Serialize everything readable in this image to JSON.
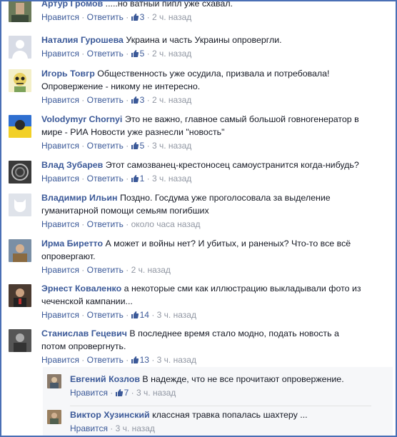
{
  "like_label": "Нравится",
  "reply_label": "Ответить",
  "separator": "·",
  "comments": [
    {
      "author": "Артур Громов",
      "text": ".....но ватный пипл уже схавал.",
      "likes": "3",
      "time": "2 ч. назад"
    },
    {
      "author": "Наталия Гурошева",
      "text": "Украина и часть Украины опровергли.",
      "likes": "5",
      "time": "2 ч. назад"
    },
    {
      "author": "Игорь Товгр",
      "text_line1": "Общественность уже осудила, призвала и потребовала!",
      "text_line2": "Опровержение - никому не интересно.",
      "likes": "3",
      "time": "2 ч. назад"
    },
    {
      "author": "Volodymyr Chornyi",
      "text_line1": "Это не важно, главное самый большой говногенератор в",
      "text_line2": "мире - РИА Новости уже разнесли \"новость\"",
      "likes": "5",
      "time": "3 ч. назад"
    },
    {
      "author": "Влад Зубарев",
      "text": "Этот самозванец-крестоносец самоустранится когда-нибудь?",
      "likes": "1",
      "time": "3 ч. назад"
    },
    {
      "author": "Владимир Ильин",
      "text_line1": "Поздно. Госдума уже проголосовала за выделение",
      "text_line2": "гуманитарной помощи семьям погибших",
      "likes": "",
      "time": "около часа назад"
    },
    {
      "author": "Ирма Биретто",
      "text_line1": "А может и войны нет? И убитых, и раненых? Что-то все всё",
      "text_line2": "опровергают.",
      "likes": "",
      "time": "2 ч. назад"
    },
    {
      "author": "Эрнест Коваленко",
      "text_line1": "а некоторые сми как иллюстрацию выкладывали фото из",
      "text_line2": "чеченской кампании...",
      "likes": "14",
      "time": "3 ч. назад"
    },
    {
      "author": "Станислав Гецевич",
      "text_line1": "В последнее время стало модно, подать новость а",
      "text_line2": "потом опровергнуть.",
      "likes": "13",
      "time": "3 ч. назад"
    }
  ],
  "replies": [
    {
      "author": "Евгений Козлов",
      "text": "В надежде, что не все прочитают опровержение.",
      "likes": "7",
      "time": "3 ч. назад"
    },
    {
      "author": "Виктор Хузинский",
      "text": "классная травка попалась шахтеру ...",
      "likes": "",
      "time": "3 ч. назад"
    }
  ]
}
